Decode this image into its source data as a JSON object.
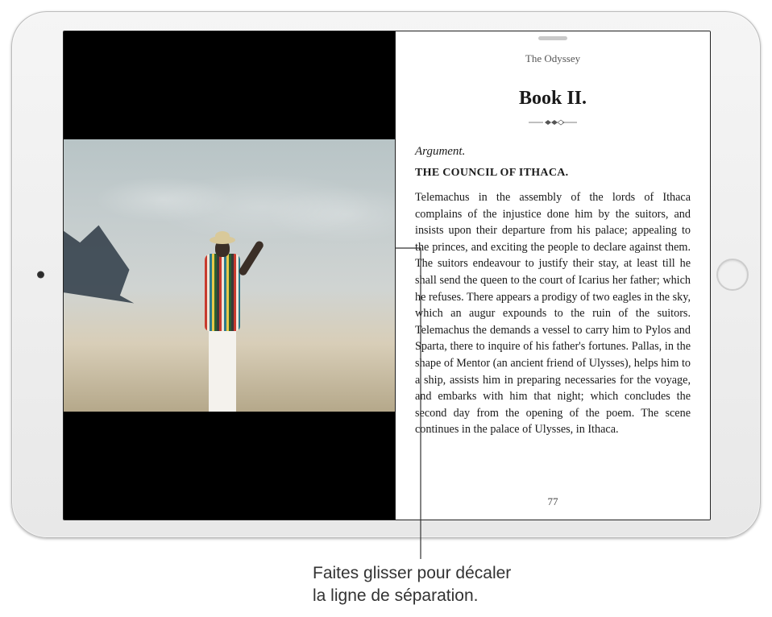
{
  "reader": {
    "book_title": "The Odyssey",
    "chapter_title": "Book II.",
    "argument_label": "Argument.",
    "subtitle": "THE COUNCIL OF ITHACA.",
    "body": "Telemachus in the assembly of the lords of Ithaca complains of the injustice done him by the suitors, and insists upon their departure from his palace; appealing to the princes, and exciting the people to declare against them. The suitors endeavour to justify their stay, at least till he shall send the queen to the court of Icarius her father; which he refuses. There appears a prodigy of two eagles in the sky, which an augur expounds to the ruin of the suitors. Telemachus the demands a vessel to carry him to Pylos and Sparta, there to inquire of his father's fortunes. Pallas, in the shape of Mentor (an ancient friend of Ulysses), helps him to a ship, assists him in preparing necessaries for the voyage, and embarks with him that night; which concludes the second day from the opening of the poem. The scene continues in the palace of Ulysses, in Ithaca.",
    "page_number": "77"
  },
  "callout": {
    "line1": "Faites glisser pour décaler",
    "line2": "la ligne de séparation."
  }
}
